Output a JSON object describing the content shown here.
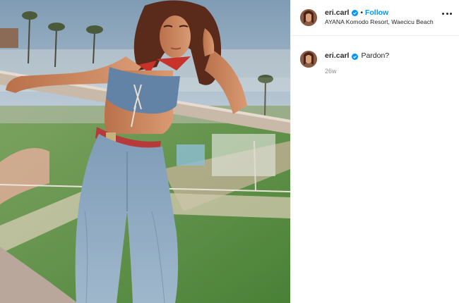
{
  "post": {
    "author": {
      "username": "eri.carl",
      "verified": true,
      "location": "AYANA Komodo Resort, Waecicu Beach"
    },
    "follow_separator": "•",
    "follow_label": "Follow",
    "caption": {
      "username": "eri.carl",
      "text": "Pardon?",
      "timestamp": "26w"
    },
    "photo_label": "woman-on-balcony-photo"
  },
  "colors": {
    "follow": "#0095f6",
    "verified": "#0095f6",
    "text": "#262626",
    "muted": "#8e8e8e",
    "border": "#efefef"
  }
}
